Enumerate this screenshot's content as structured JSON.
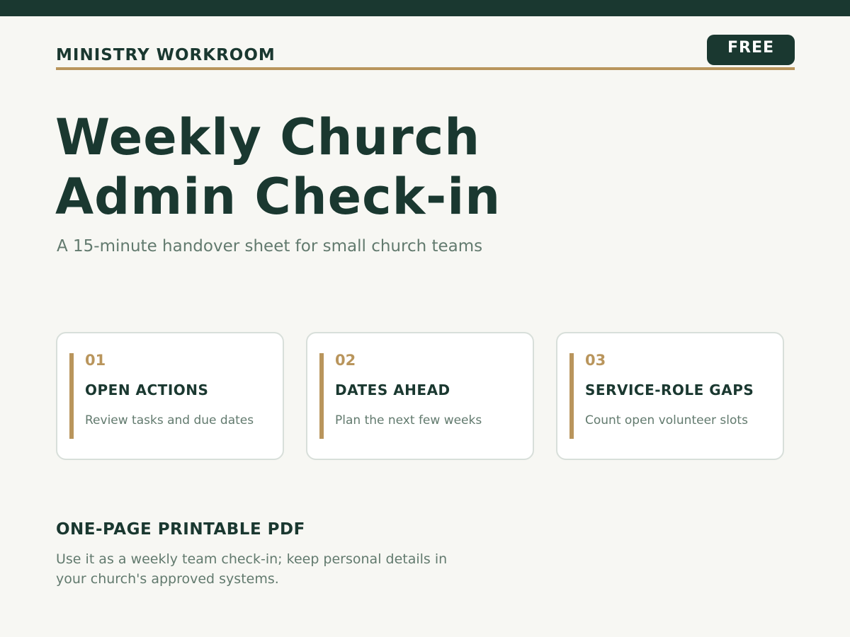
{
  "header": {
    "brand": "MINISTRY WORKROOM",
    "badge": "FREE"
  },
  "hero": {
    "title_line1": "Weekly Church",
    "title_line2": "Admin Check-in",
    "subtitle": "A 15-minute handover sheet for small church teams"
  },
  "cards": [
    {
      "number": "01",
      "title": "OPEN ACTIONS",
      "description": "Review tasks and due dates"
    },
    {
      "number": "02",
      "title": "DATES AHEAD",
      "description": "Plan the next few weeks"
    },
    {
      "number": "03",
      "title": "SERVICE-ROLE GAPS",
      "description": "Count open volunteer slots"
    }
  ],
  "footer": {
    "heading": "ONE-PAGE PRINTABLE PDF",
    "text": "Use it as a weekly team check-in; keep personal details in your church's approved systems."
  },
  "colors": {
    "primary": "#1a3830",
    "accent": "#b9955c",
    "muted_text": "#627a6e",
    "background": "#f7f7f3"
  }
}
